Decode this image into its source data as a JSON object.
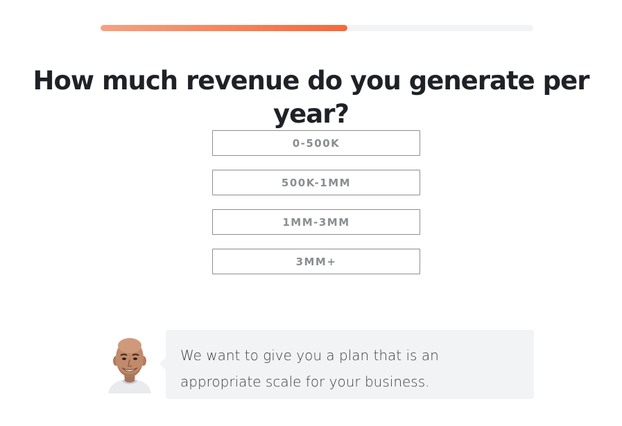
{
  "progress": {
    "fraction": 0.57,
    "fill_color_start": "#f4a282",
    "fill_color_end": "#f26a3b",
    "track_color": "#f2f3f4"
  },
  "question": {
    "title": "How much revenue do you generate per year?"
  },
  "options": [
    {
      "label": "0-500K"
    },
    {
      "label": "500K-1MM"
    },
    {
      "label": "1MM-3MM"
    },
    {
      "label": "3MM+"
    }
  ],
  "advisor": {
    "avatar_icon": "advisor-photo",
    "message": "We want to give you a plan that is an appropriate scale for your business."
  }
}
